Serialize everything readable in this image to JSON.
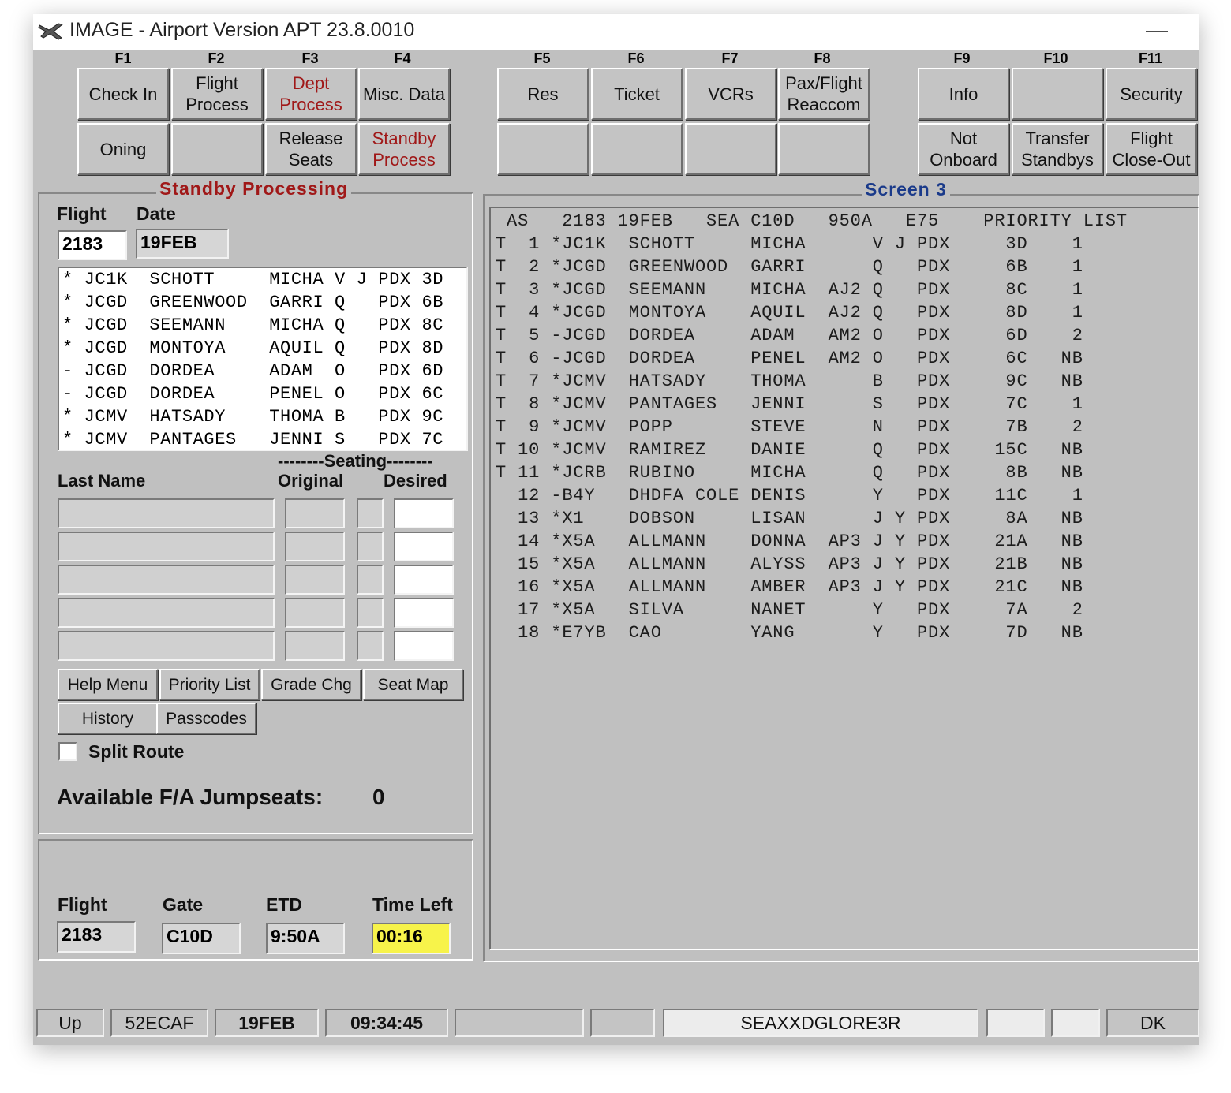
{
  "window": {
    "title": "IMAGE - Airport Version APT 23.8.0010",
    "minimize": "—"
  },
  "fkeys": [
    "F1",
    "F2",
    "F3",
    "F4",
    "F5",
    "F6",
    "F7",
    "F8",
    "F9",
    "F10",
    "F11"
  ],
  "buttons": {
    "check_in": "Check In",
    "flight_process": "Flight\nProcess",
    "dept_process": "Dept\nProcess",
    "misc_data": "Misc. Data",
    "res": "Res",
    "ticket": "Ticket",
    "vcrs": "VCRs",
    "pax_flight_reaccom": "Pax/Flight\nReaccom",
    "info": "Info",
    "security": "Security",
    "oning": "Oning",
    "release_seats": "Release\nSeats",
    "standby_process": "Standby\nProcess",
    "not_onboard": "Not\nOnboard",
    "transfer_standbys": "Transfer\nStandbys",
    "flight_close_out": "Flight\nClose-Out"
  },
  "standby": {
    "title": "Standby Processing",
    "flight_label": "Flight",
    "date_label": "Date",
    "flight_value": "2183",
    "date_value": "19FEB",
    "list": [
      "* JC1K  SCHOTT     MICHA V J PDX 3D",
      "* JCGD  GREENWOOD  GARRI Q   PDX 6B",
      "* JCGD  SEEMANN    MICHA Q   PDX 8C",
      "* JCGD  MONTOYA    AQUIL Q   PDX 8D",
      "- JCGD  DORDEA     ADAM  O   PDX 6D",
      "- JCGD  DORDEA     PENEL O   PDX 6C",
      "* JCMV  HATSADY    THOMA B   PDX 9C",
      "* JCMV  PANTAGES   JENNI S   PDX 7C"
    ],
    "seating_label": "--------Seating--------",
    "last_name_label": "Last Name",
    "original_label": "Original",
    "desired_label": "Desired",
    "help_menu": "Help Menu",
    "priority_list": "Priority List",
    "grade_chg": "Grade Chg",
    "seat_map": "Seat Map",
    "history": "History",
    "passcodes": "Passcodes",
    "split_route": "Split Route",
    "jumpseats_label": "Available F/A Jumpseats:",
    "jumpseats_value": "0"
  },
  "flight_info": {
    "flight_label": "Flight",
    "flight_value": "2183",
    "gate_label": "Gate",
    "gate_value": "C10D",
    "etd_label": "ETD",
    "etd_value": "9:50A",
    "time_left_label": "Time Left",
    "time_left_value": "00:16"
  },
  "screen3": {
    "title": "Screen 3",
    "header": " AS   2183 19FEB   SEA C10D   950A   E75    PRIORITY LIST",
    "rows": [
      "T  1 *JC1K  SCHOTT     MICHA      V J PDX     3D    1",
      "T  2 *JCGD  GREENWOOD  GARRI      Q   PDX     6B    1",
      "T  3 *JCGD  SEEMANN    MICHA  AJ2 Q   PDX     8C    1",
      "T  4 *JCGD  MONTOYA    AQUIL  AJ2 Q   PDX     8D    1",
      "T  5 -JCGD  DORDEA     ADAM   AM2 O   PDX     6D    2",
      "T  6 -JCGD  DORDEA     PENEL  AM2 O   PDX     6C   NB",
      "T  7 *JCMV  HATSADY    THOMA      B   PDX     9C   NB",
      "T  8 *JCMV  PANTAGES   JENNI      S   PDX     7C    1",
      "T  9 *JCMV  POPP       STEVE      N   PDX     7B    2",
      "T 10 *JCMV  RAMIREZ    DANIE      Q   PDX    15C   NB",
      "T 11 *JCRB  RUBINO     MICHA      Q   PDX     8B   NB",
      "  12 -B4Y   DHDFA COLE DENIS      Y   PDX    11C    1",
      "  13 *X1    DOBSON     LISAN      J Y PDX     8A   NB",
      "  14 *X5A   ALLMANN    DONNA  AP3 J Y PDX    21A   NB",
      "  15 *X5A   ALLMANN    ALYSS  AP3 J Y PDX    21B   NB",
      "  16 *X5A   ALLMANN    AMBER  AP3 J Y PDX    21C   NB",
      "  17 *X5A   SILVA      NANET      Y   PDX     7A    2",
      "  18 *E7YB  CAO        YANG       Y   PDX     7D   NB"
    ]
  },
  "statusbar": {
    "up": "Up",
    "code": "52ECAF",
    "date": "19FEB",
    "time": "09:34:45",
    "agent": "SEAXXDGLORE3R",
    "dk": "DK"
  },
  "colors": {
    "active_button_text": "#a01818",
    "title_blue": "#1a3a8a",
    "time_left_bg": "#f7f34a"
  }
}
